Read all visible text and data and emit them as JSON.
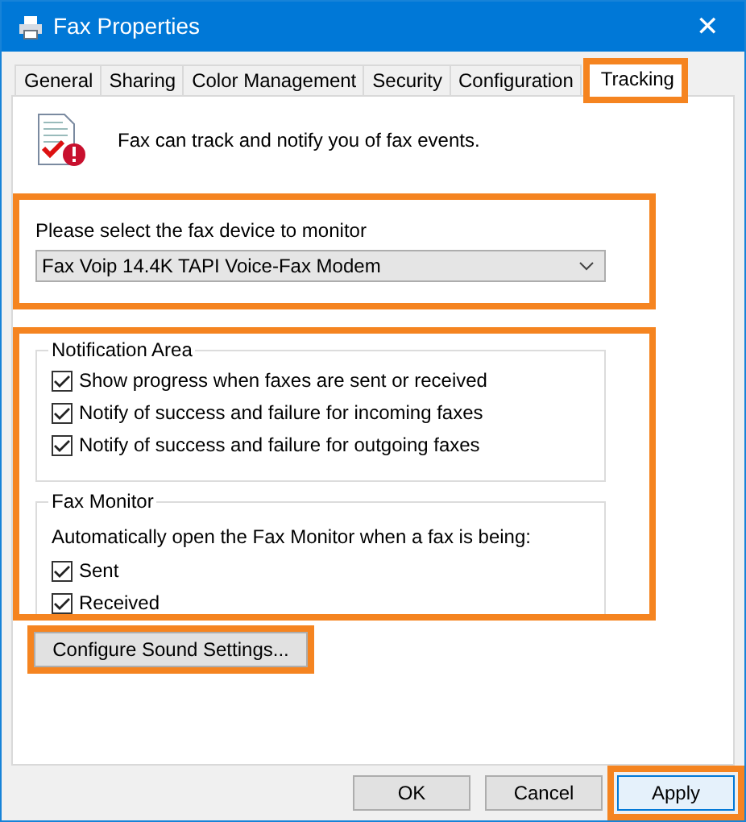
{
  "window": {
    "title": "Fax Properties",
    "close": "✕"
  },
  "tabs": [
    {
      "label": "General",
      "selected": false,
      "highlighted": false
    },
    {
      "label": "Sharing",
      "selected": false,
      "highlighted": false
    },
    {
      "label": "Color Management",
      "selected": false,
      "highlighted": false
    },
    {
      "label": "Security",
      "selected": false,
      "highlighted": false
    },
    {
      "label": "Configuration",
      "selected": false,
      "highlighted": false
    },
    {
      "label": "Tracking",
      "selected": true,
      "highlighted": true
    }
  ],
  "intro": "Fax can track and notify you of fax events.",
  "device": {
    "label": "Please select the fax device to monitor",
    "value": "Fax Voip 14.4K TAPI Voice-Fax Modem",
    "highlighted": true
  },
  "options": {
    "highlighted": true,
    "groups": [
      {
        "title": "Notification Area",
        "items": [
          {
            "label": "Show progress when faxes are sent or received",
            "checked": true
          },
          {
            "label": "Notify of success and failure for incoming faxes",
            "checked": true
          },
          {
            "label": "Notify of success and failure for outgoing faxes",
            "checked": true
          }
        ]
      },
      {
        "title": "Fax Monitor",
        "text": "Automatically open the Fax Monitor when a fax is being:",
        "items": [
          {
            "label": "Sent",
            "checked": true
          },
          {
            "label": "Received",
            "checked": true
          }
        ]
      }
    ]
  },
  "sound_button": {
    "label": "Configure Sound Settings...",
    "highlighted": true
  },
  "buttons": [
    {
      "label": "OK",
      "highlighted": false,
      "focused": false
    },
    {
      "label": "Cancel",
      "highlighted": false,
      "focused": false
    },
    {
      "label": "Apply",
      "highlighted": true,
      "focused": true
    }
  ]
}
